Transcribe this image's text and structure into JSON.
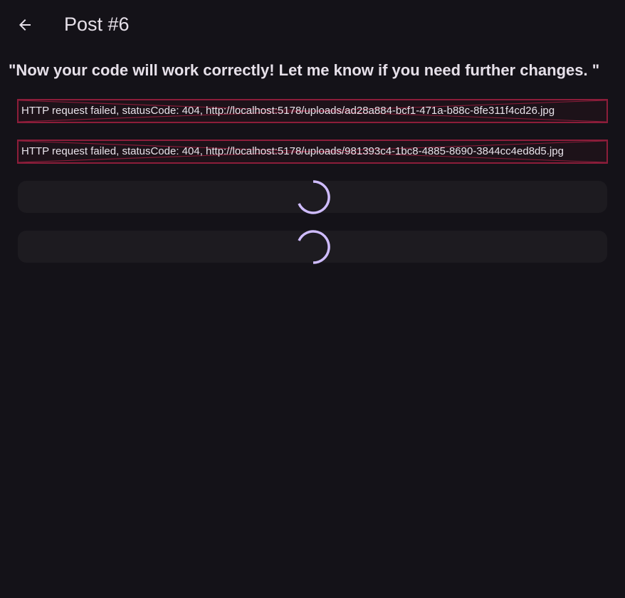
{
  "app_bar": {
    "title": "Post #6",
    "back_icon": "arrow-back-icon"
  },
  "post": {
    "text": "\"Now your code will work correctly! Let me know if you need further changes. \""
  },
  "images": [
    {
      "status": "error",
      "error_text": "HTTP request failed, statusCode: 404, http://localhost:5178/uploads/ad28a884-bcf1-471a-b88c-8fe311f4cd26.jpg"
    },
    {
      "status": "error",
      "error_text": "HTTP request failed, statusCode: 404, http://localhost:5178/uploads/981393c4-1bc8-4885-8690-3844cc4ed8d5.jpg"
    },
    {
      "status": "loading",
      "icon": "progress-spinner-icon"
    },
    {
      "status": "loading",
      "icon": "progress-spinner-icon"
    }
  ],
  "colors": {
    "background": "#141218",
    "text": "#e6e0e9",
    "error_border": "#8c1d3a",
    "spinner": "#cfbcff",
    "card": "#1d1b20"
  }
}
